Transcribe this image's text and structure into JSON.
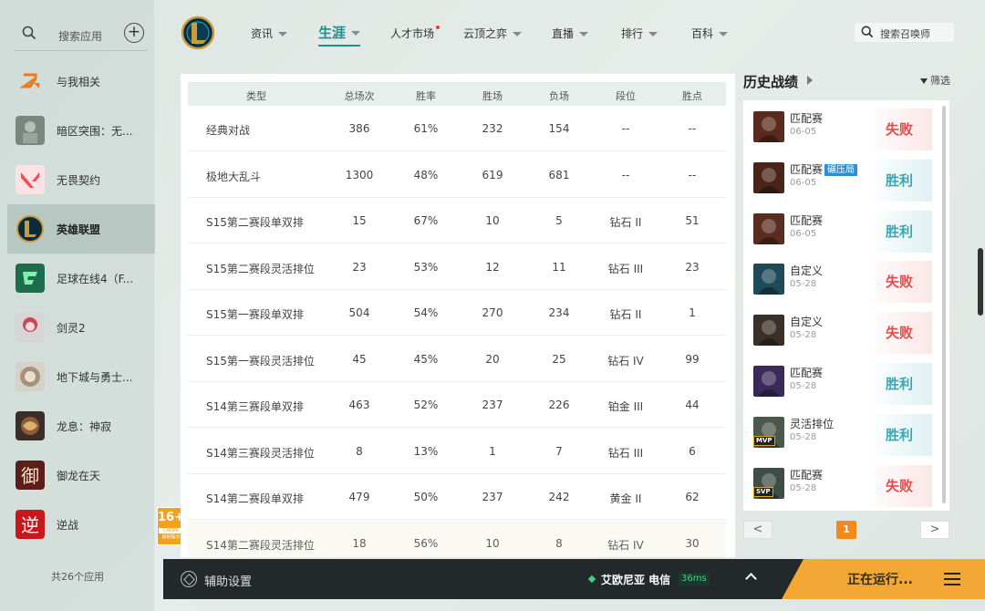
{
  "sidebar": {
    "search_placeholder": "搜索应用",
    "items": [
      {
        "label": "与我相关",
        "icon": "related-icon",
        "active": false
      },
      {
        "label": "暗区突围：无...",
        "icon": "arena-breakout-icon",
        "active": false
      },
      {
        "label": "无畏契约",
        "icon": "valorant-icon",
        "active": false
      },
      {
        "label": "英雄联盟",
        "icon": "league-of-legends-icon",
        "active": true
      },
      {
        "label": "足球在线4（F...",
        "icon": "fifa-online-icon",
        "active": false
      },
      {
        "label": "剑灵2",
        "icon": "blade-soul-icon",
        "active": false
      },
      {
        "label": "地下城与勇士...",
        "icon": "dnf-icon",
        "active": false
      },
      {
        "label": "龙息：神寂",
        "icon": "dragon-breath-icon",
        "active": false
      },
      {
        "label": "御龙在天",
        "icon": "yulong-icon",
        "active": false
      },
      {
        "label": "逆战",
        "icon": "nizhan-icon",
        "active": false
      }
    ],
    "count_label": "共26个应用",
    "age_badge": {
      "number": "16+",
      "text1": "CADPA",
      "text2": "适龄提示"
    }
  },
  "nav": {
    "items": [
      {
        "label": "资讯",
        "caret": true,
        "active": false
      },
      {
        "label": "生涯",
        "caret": true,
        "active": true
      },
      {
        "label": "人才市场",
        "caret": false,
        "dot": true,
        "active": false
      },
      {
        "label": "云顶之弈",
        "caret": true,
        "active": false
      },
      {
        "label": "直播",
        "caret": true,
        "active": false
      },
      {
        "label": "排行",
        "caret": true,
        "active": false
      },
      {
        "label": "百科",
        "caret": true,
        "active": false
      }
    ],
    "search_placeholder": "搜索召唤师"
  },
  "stats_table": {
    "headers": [
      "类型",
      "总场次",
      "胜率",
      "胜场",
      "负场",
      "段位",
      "胜点"
    ],
    "rows": [
      [
        "经典对战",
        "386",
        "61%",
        "232",
        "154",
        "--",
        "--"
      ],
      [
        "极地大乱斗",
        "1300",
        "48%",
        "619",
        "681",
        "--",
        "--"
      ],
      [
        "S15第二赛段单双排",
        "15",
        "67%",
        "10",
        "5",
        "钻石 II",
        "51"
      ],
      [
        "S15第二赛段灵活排位",
        "23",
        "53%",
        "12",
        "11",
        "钻石 III",
        "23"
      ],
      [
        "S15第一赛段单双排",
        "504",
        "54%",
        "270",
        "234",
        "钻石 II",
        "1"
      ],
      [
        "S15第一赛段灵活排位",
        "45",
        "45%",
        "20",
        "25",
        "钻石 IV",
        "99"
      ],
      [
        "S14第三赛段单双排",
        "463",
        "52%",
        "237",
        "226",
        "铂金 III",
        "44"
      ],
      [
        "S14第三赛段灵活排位",
        "8",
        "13%",
        "1",
        "7",
        "钻石 III",
        "6"
      ],
      [
        "S14第二赛段单双排",
        "479",
        "50%",
        "237",
        "242",
        "黄金 II",
        "62"
      ],
      [
        "S14第二赛段灵活排位",
        "18",
        "56%",
        "10",
        "8",
        "钻石 IV",
        "30"
      ]
    ]
  },
  "history": {
    "title": "历史战绩",
    "filter_label": "筛选",
    "matches": [
      {
        "type": "匹配赛",
        "tag": "",
        "date": "06-05",
        "result": "失败",
        "win": false,
        "badge": "",
        "champ_color": "#5a2a1e"
      },
      {
        "type": "匹配赛",
        "tag": "碾压局",
        "date": "06-05",
        "result": "胜利",
        "win": true,
        "badge": "",
        "champ_color": "#4a2418"
      },
      {
        "type": "匹配赛",
        "tag": "",
        "date": "06-05",
        "result": "胜利",
        "win": true,
        "badge": "",
        "champ_color": "#5b2c20"
      },
      {
        "type": "自定义",
        "tag": "",
        "date": "05-28",
        "result": "失败",
        "win": false,
        "badge": "",
        "champ_color": "#1f4a5a"
      },
      {
        "type": "自定义",
        "tag": "",
        "date": "05-28",
        "result": "失败",
        "win": false,
        "badge": "",
        "champ_color": "#3a3028"
      },
      {
        "type": "匹配赛",
        "tag": "",
        "date": "05-28",
        "result": "胜利",
        "win": true,
        "badge": "",
        "champ_color": "#3a2a5a"
      },
      {
        "type": "灵活排位",
        "tag": "",
        "date": "05-28",
        "result": "胜利",
        "win": true,
        "badge": "MVP",
        "champ_color": "#4a5a4a"
      },
      {
        "type": "匹配赛",
        "tag": "",
        "date": "05-28",
        "result": "失败",
        "win": false,
        "badge": "SVP",
        "champ_color": "#3e4e46"
      }
    ],
    "pager": {
      "prev": "<",
      "current": "1",
      "next": ">"
    }
  },
  "bottom_bar": {
    "settings_label": "辅助设置",
    "server": "艾欧尼亚 电信",
    "ping": "36ms",
    "running_label": "正在运行..."
  }
}
